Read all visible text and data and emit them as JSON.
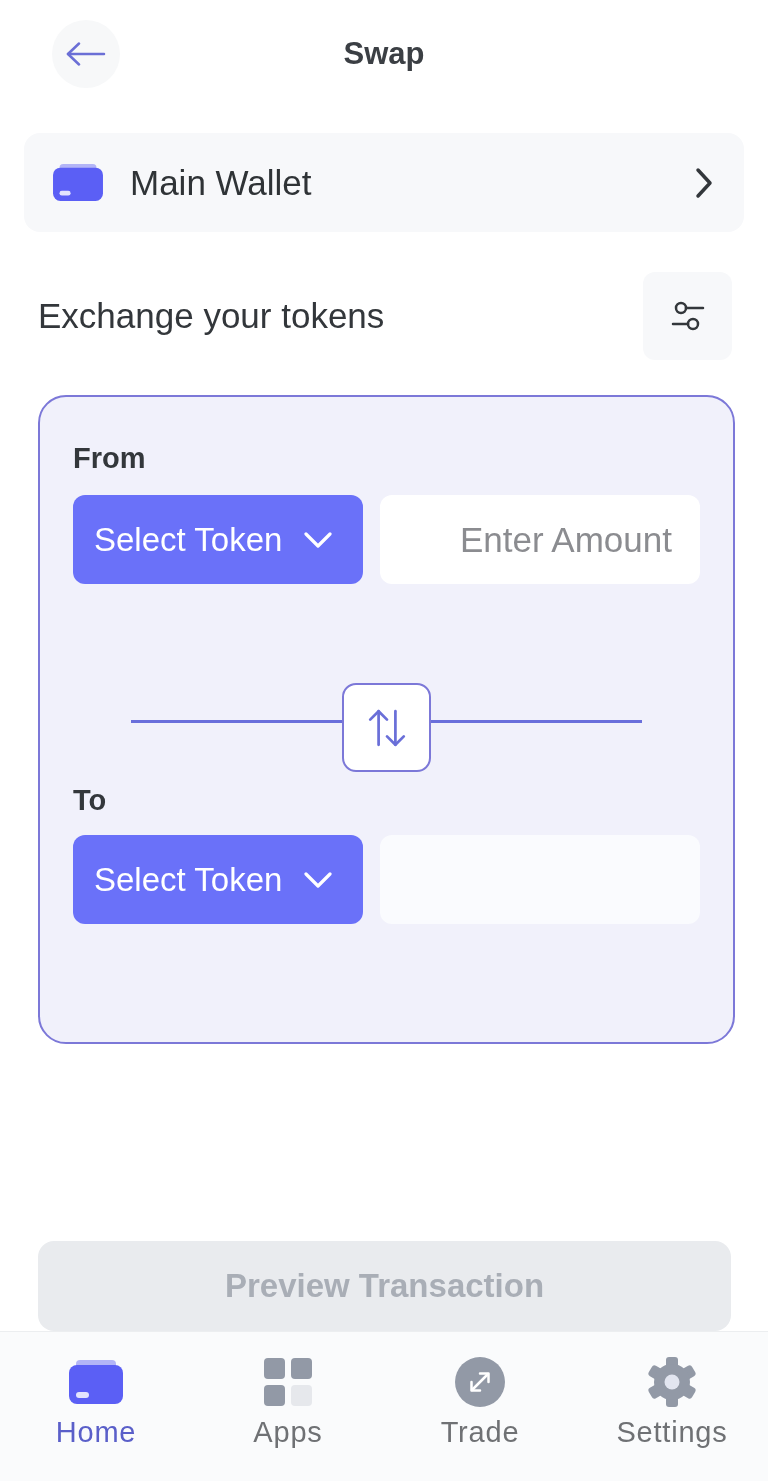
{
  "header": {
    "title": "Swap"
  },
  "wallet": {
    "name": "Main Wallet"
  },
  "exchange": {
    "title": "Exchange your tokens"
  },
  "swap_card": {
    "from": {
      "label": "From",
      "token_button": "Select Token",
      "amount": {
        "placeholder": "Enter Amount"
      }
    },
    "to": {
      "label": "To",
      "token_button": "Select Token"
    }
  },
  "preview_button": {
    "label": "Preview Transaction",
    "disabled": true
  },
  "nav": {
    "items": [
      {
        "label": "Home",
        "selected": true
      },
      {
        "label": "Apps",
        "selected": false
      },
      {
        "label": "Trade",
        "selected": false
      },
      {
        "label": "Settings",
        "selected": false
      }
    ]
  }
}
